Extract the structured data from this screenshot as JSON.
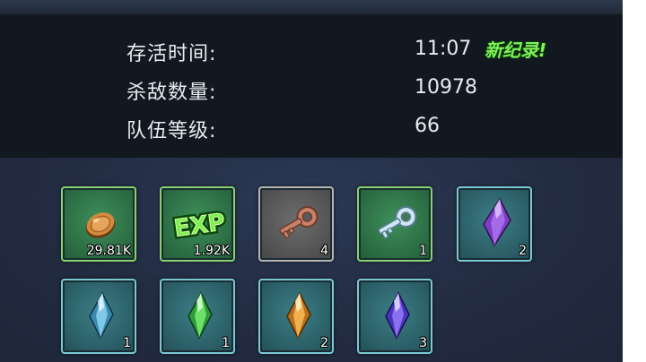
{
  "stats": {
    "survival_time_label": "存活时间:",
    "survival_time_value": "11:07",
    "new_record_badge": "新纪录!",
    "kills_label": "杀敌数量:",
    "kills_value": "10978",
    "team_level_label": "队伍等级:",
    "team_level_value": "66"
  },
  "rewards": {
    "items": [
      {
        "icon": "gold-coin-icon",
        "rarity_color": "green",
        "count": "29.81K"
      },
      {
        "icon": "exp-icon",
        "rarity_color": "green",
        "count": "1.92K"
      },
      {
        "icon": "bronze-key-icon",
        "rarity_color": "gray",
        "count": "4"
      },
      {
        "icon": "silver-key-icon",
        "rarity_color": "green",
        "count": "1"
      },
      {
        "icon": "purple-crystal-icon",
        "rarity_color": "teal",
        "count": "2"
      },
      {
        "icon": "cyan-crystal-icon",
        "rarity_color": "teal",
        "count": "1"
      },
      {
        "icon": "green-crystal-icon",
        "rarity_color": "teal",
        "count": "1"
      },
      {
        "icon": "orange-crystal-icon",
        "rarity_color": "teal",
        "count": "2"
      },
      {
        "icon": "violet-crystal-icon",
        "rarity_color": "teal",
        "count": "3"
      }
    ]
  },
  "colors": {
    "record_green": "#7df25a",
    "panel_dark": "#121820",
    "text_light": "#e8ecf0"
  }
}
